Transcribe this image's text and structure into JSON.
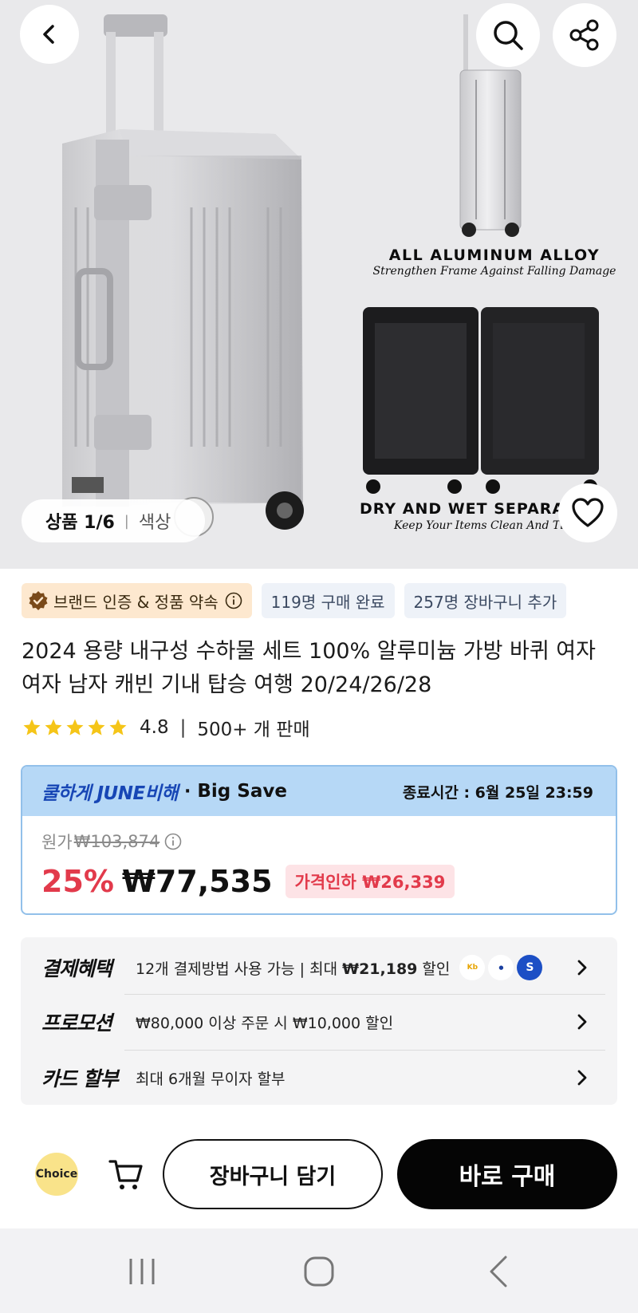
{
  "gallery": {
    "counter": "상품 1/6",
    "option_label": "색상",
    "caption1_title": "ALL ALUMINUM  ALLOY",
    "caption1_sub": "Strengthen Frame Against Falling Damage",
    "caption2_title": "DRY AND WET SEPARA",
    "caption2_sub": "Keep Your Items Clean And Tid"
  },
  "badges": {
    "brand": "브랜드 인증 & 정품 약속",
    "purchased": "119명 구매 완료",
    "carted": "257명 장바구니 추가"
  },
  "product": {
    "title": "2024 용량 내구성 수하물 세트 100% 알루미늄 가방 바퀴 여자 여자 남자 캐빈 기내 탑승 여행 20/24/26/28",
    "rating": "4.8",
    "rating_stars": 5,
    "sold": "500+ 개 판매"
  },
  "price": {
    "event_name": "쿨하게 JUNE비해",
    "event_tag": "Big Save",
    "end_time": "종료시간 :  6월 25일 23:59",
    "original_label": "원가",
    "original_price": "₩103,874",
    "discount_pct": "25%",
    "current_price": "₩77,535",
    "price_cut": "가격인하 ₩26,339"
  },
  "benefits": {
    "payment_label": "결제혜택",
    "payment_desc_prefix": "12개 결제방법 사용 가능 | 최대 ",
    "payment_desc_amount": "₩21,189",
    "payment_desc_suffix": " 할인",
    "promotion_label": "프로모션",
    "promotion_desc": "₩80,000 이상 주문 시 ₩10,000 할인",
    "installment_label": "카드 할부",
    "installment_desc": "최대 6개월 무이자 할부"
  },
  "actions": {
    "choice_label": "Choice",
    "add_to_cart": "장바구니 담기",
    "buy_now": "바로 구매"
  },
  "colors": {
    "accent_red": "#e23a4b",
    "event_blue": "#1746b5",
    "event_bg": "#b6d8f6"
  }
}
